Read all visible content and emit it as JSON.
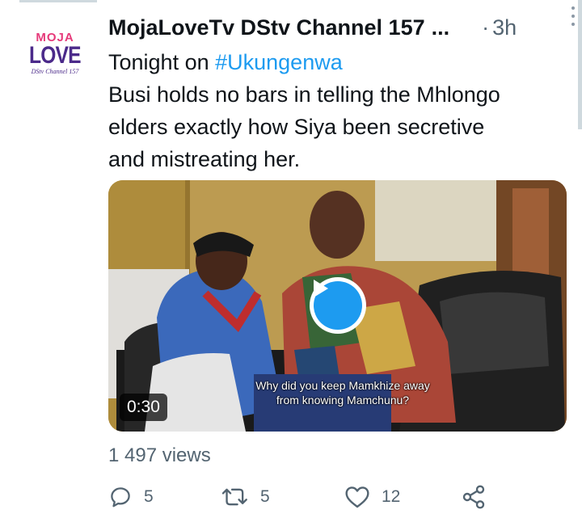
{
  "tweet": {
    "author_name": "MojaLoveTv DStv Channel 157",
    "author_truncation": "...",
    "separator": "·",
    "time": "3h",
    "avatar": {
      "line1": "MOJA",
      "line2": "LOVE",
      "line3": "DStv Channel 157"
    },
    "text": {
      "line1_prefix": "Tonight on ",
      "hashtag": "#Ukungenwa",
      "line2": "Busi holds no bars in telling the Mhlongo",
      "line3": "elders exactly how Siya been secretive",
      "line4": "and mistreating her."
    },
    "video": {
      "duration": "0:30",
      "subtitle_line1": "Why did you keep Mamkhize away",
      "subtitle_line2": "from knowing Mamchunu?"
    },
    "views": "1 497 views",
    "actions": {
      "reply_count": "5",
      "retweet_count": "5",
      "like_count": "12"
    }
  },
  "icons": {
    "more": "more-vertical-icon",
    "reply": "reply-icon",
    "retweet": "retweet-icon",
    "like": "heart-icon",
    "share": "share-icon",
    "play": "play-icon"
  },
  "colors": {
    "accent": "#1d9bf0",
    "text": "#0f1419",
    "muted": "#536471",
    "brand_pink": "#e63a7a",
    "brand_purple": "#4b2a8a"
  }
}
